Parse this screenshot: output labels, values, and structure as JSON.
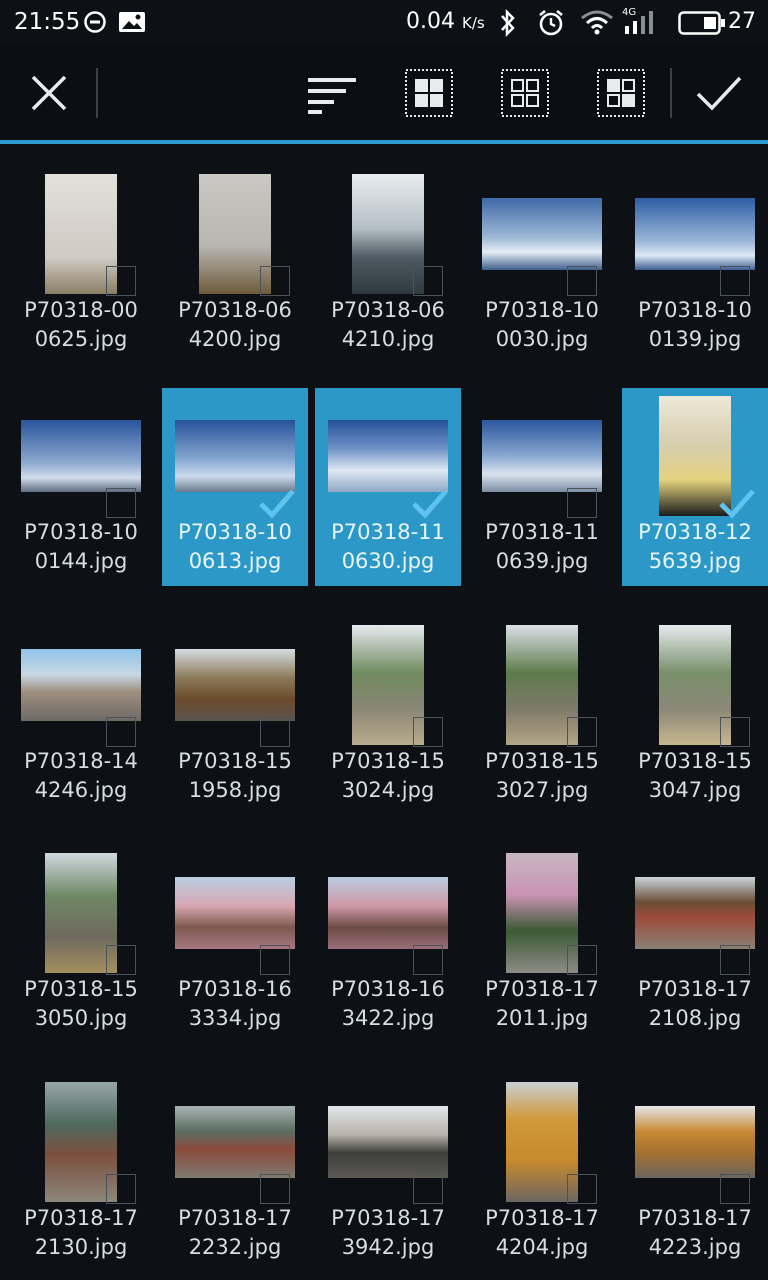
{
  "status_bar": {
    "time": "21:55",
    "net_speed": "0.04",
    "net_unit": "K/s",
    "battery": "27",
    "network": "4G"
  },
  "toolbar": {
    "close_icon": "close-icon",
    "sort_icon": "sort-icon",
    "grid_icons": [
      "grid-large-icon",
      "grid-medium-icon",
      "grid-small-icon"
    ],
    "confirm_icon": "check-icon"
  },
  "colors": {
    "accent": "#2a9bd2",
    "background": "#0d1116",
    "selected": "#2b98c8"
  },
  "files": [
    {
      "name1": "P70318-00",
      "name2": "0625.jpg",
      "selected": false
    },
    {
      "name1": "P70318-06",
      "name2": "4200.jpg",
      "selected": false
    },
    {
      "name1": "P70318-06",
      "name2": "4210.jpg",
      "selected": false
    },
    {
      "name1": "P70318-10",
      "name2": "0030.jpg",
      "selected": false
    },
    {
      "name1": "P70318-10",
      "name2": "0139.jpg",
      "selected": false
    },
    {
      "name1": "P70318-10",
      "name2": "0144.jpg",
      "selected": false
    },
    {
      "name1": "P70318-10",
      "name2": "0613.jpg",
      "selected": true
    },
    {
      "name1": "P70318-11",
      "name2": "0630.jpg",
      "selected": true
    },
    {
      "name1": "P70318-11",
      "name2": "0639.jpg",
      "selected": false
    },
    {
      "name1": "P70318-12",
      "name2": "5639.jpg",
      "selected": true
    },
    {
      "name1": "P70318-14",
      "name2": "4246.jpg",
      "selected": false
    },
    {
      "name1": "P70318-15",
      "name2": "1958.jpg",
      "selected": false
    },
    {
      "name1": "P70318-15",
      "name2": "3024.jpg",
      "selected": false
    },
    {
      "name1": "P70318-15",
      "name2": "3027.jpg",
      "selected": false
    },
    {
      "name1": "P70318-15",
      "name2": "3047.jpg",
      "selected": false
    },
    {
      "name1": "P70318-15",
      "name2": "3050.jpg",
      "selected": false
    },
    {
      "name1": "P70318-16",
      "name2": "3334.jpg",
      "selected": false
    },
    {
      "name1": "P70318-16",
      "name2": "3422.jpg",
      "selected": false
    },
    {
      "name1": "P70318-17",
      "name2": "2011.jpg",
      "selected": false
    },
    {
      "name1": "P70318-17",
      "name2": "2108.jpg",
      "selected": false
    },
    {
      "name1": "P70318-17",
      "name2": "2130.jpg",
      "selected": false
    },
    {
      "name1": "P70318-17",
      "name2": "2232.jpg",
      "selected": false
    },
    {
      "name1": "P70318-17",
      "name2": "3942.jpg",
      "selected": false
    },
    {
      "name1": "P70318-17",
      "name2": "4204.jpg",
      "selected": false
    },
    {
      "name1": "P70318-17",
      "name2": "4223.jpg",
      "selected": false
    }
  ]
}
